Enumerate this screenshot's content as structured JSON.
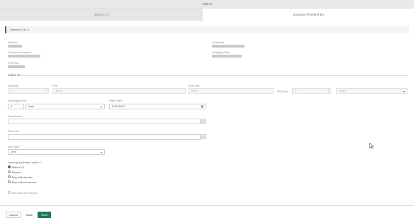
{
  "window": {
    "title": "Add CI"
  },
  "tabs": [
    {
      "label": "SELECT CI"
    },
    {
      "label": "LEASING PROPERTIES"
    }
  ],
  "selected_bar": {
    "text": "Selected CIs: 2"
  },
  "info": {
    "product_label": "Product",
    "customer_label": "Customer",
    "customer_account_label": "Customer Account",
    "charging_plan_label": "Charging Plan",
    "price_list_label": "Price list"
  },
  "lease_section": {
    "title": "Lease CI"
  },
  "fields": {
    "quantity_label": "Quantity",
    "quantity_value": "1",
    "fee_label": "Fee",
    "fee_value": "10.00",
    "total_fee_label": "Total Fee",
    "total_fee_value": "10.00",
    "eur_per_label": "EUR per",
    "eur_per_value": "1",
    "eur_per_unit": "Days",
    "leasing_period_label": "Leasing period *",
    "leasing_period_value": "3",
    "leasing_period_unit": "Days",
    "start_date_label": "Start date *",
    "start_date_value": "6/21/2022",
    "cost_center_label": "CostCenter",
    "parent_ci_label": "ParentCI",
    "vat_rate_label": "VAT rate *",
    "vat_rate_value": "25%"
  },
  "expiration": {
    "label": "Leasing expiration option *",
    "options": [
      {
        "label": "Return CI",
        "selected": true
      },
      {
        "label": "Renew",
        "selected": false
      },
      {
        "label": "Buy with service",
        "selected": false
      },
      {
        "label": "Buy without service",
        "selected": false
      }
    ]
  },
  "manual": {
    "label": "Manually terminated"
  },
  "footer": {
    "cancel": "Cancel",
    "back": "Back",
    "save": "Save"
  },
  "colors": {
    "accent": "#1f7a52",
    "placeholder_blur": "#c9c9c9"
  },
  "icons": {
    "calendar": "calendar-icon",
    "lookup": "lookup-icon",
    "dropdown": "chevron-down-icon",
    "cursor": "mouse-pointer-icon"
  }
}
